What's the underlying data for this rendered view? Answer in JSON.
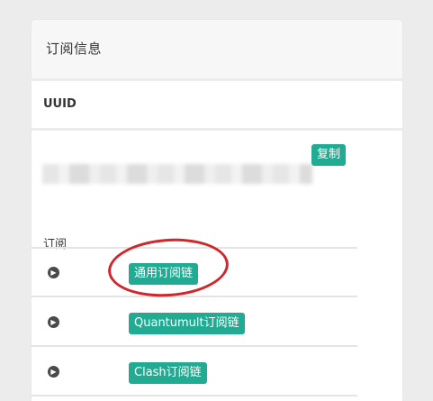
{
  "card": {
    "title": "订阅信息"
  },
  "uuid": {
    "label": "UUID",
    "value": "1a2b3c4d-5e6f-7a8b-9c0d-1e2f3a4b5c6d",
    "copy_label": "复制"
  },
  "subscription": {
    "label": "订阅",
    "items": [
      {
        "label": "通用订阅链"
      },
      {
        "label": "Quantumult订阅链"
      },
      {
        "label": "Clash订阅链"
      }
    ]
  },
  "colors": {
    "button": "#21ab92",
    "annotation": "#d0262c"
  },
  "icons": {
    "row_icon": "chevron-right-circle-icon"
  }
}
